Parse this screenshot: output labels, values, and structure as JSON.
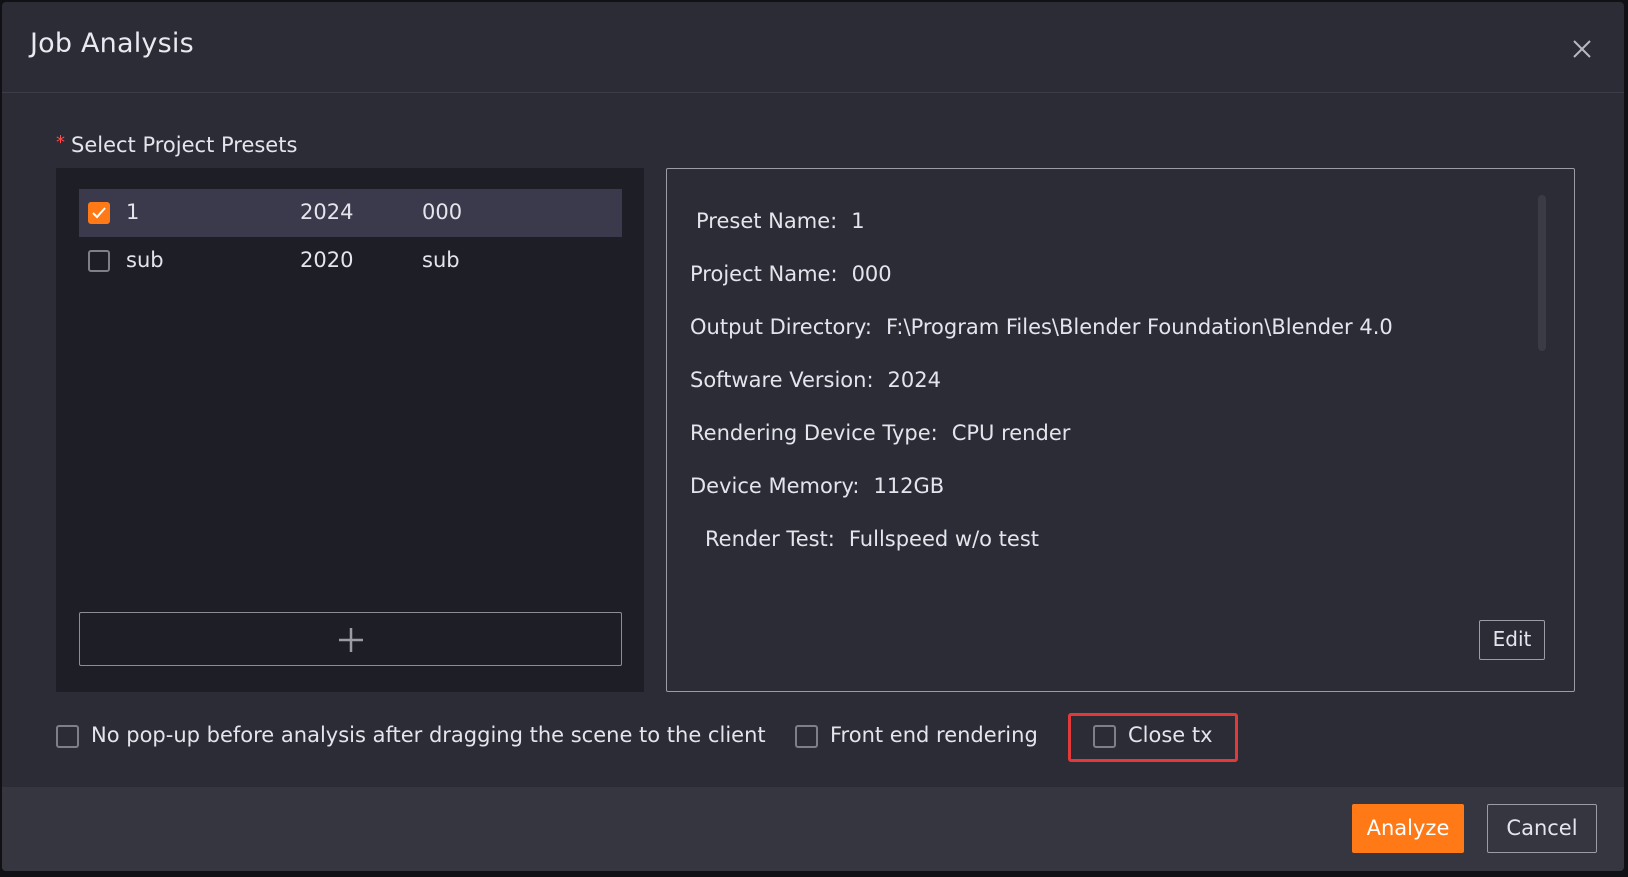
{
  "dialog": {
    "title": "Job Analysis"
  },
  "presets": {
    "label": "Select Project Presets",
    "required_mark": "*",
    "rows": [
      {
        "checked": true,
        "name": "1",
        "version": "2024",
        "project": "000"
      },
      {
        "checked": false,
        "name": "sub",
        "version": "2020",
        "project": "sub"
      }
    ]
  },
  "details": {
    "preset_name": {
      "label": "Preset Name:",
      "value": "1"
    },
    "project_name": {
      "label": "Project Name:",
      "value": "000"
    },
    "output_directory": {
      "label": "Output Directory:",
      "value": "F:\\Program Files\\Blender Foundation\\Blender 4.0"
    },
    "software_version": {
      "label": "Software Version:",
      "value": "2024"
    },
    "rendering_device_type": {
      "label": "Rendering Device Type:",
      "value": "CPU render"
    },
    "device_memory": {
      "label": "Device Memory:",
      "value": "112GB"
    },
    "render_test": {
      "label": "Render Test:",
      "value": "Fullspeed w/o test"
    },
    "edit_label": "Edit"
  },
  "options": {
    "no_popup": {
      "label": "No pop-up before analysis after dragging the scene to the client",
      "checked": false
    },
    "front_end_rendering": {
      "label": "Front end rendering",
      "checked": false
    },
    "close_tx": {
      "label": "Close tx",
      "checked": false
    }
  },
  "footer": {
    "analyze_label": "Analyze",
    "cancel_label": "Cancel"
  },
  "colors": {
    "accent": "#ff7a17",
    "highlight": "#e23a3a",
    "background": "#2b2c35"
  },
  "icons": {
    "close": "close-icon",
    "add": "plus-icon",
    "check": "checkmark-icon"
  }
}
